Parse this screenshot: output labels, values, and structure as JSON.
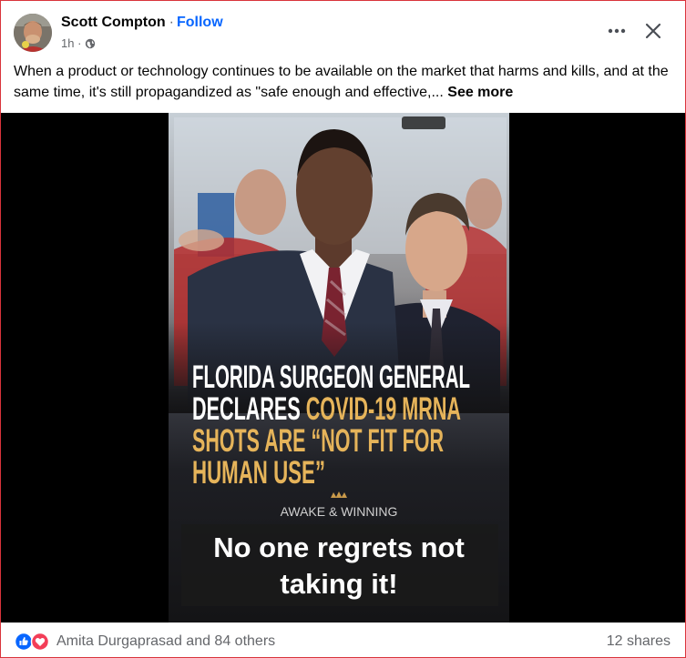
{
  "post": {
    "author": "Scott Compton",
    "separator": "·",
    "follow_label": "Follow",
    "timestamp": "1h ·",
    "audience_icon": "globe-icon",
    "text": "When a product or technology continues to be available on the market that harms and kills, and at the same time, it's still propagandized as \"safe enough and effective,... ",
    "see_more_label": "See more"
  },
  "media": {
    "headline_white_1": "FLORIDA SURGEON GENERAL",
    "headline_white_2": "DECLARES ",
    "headline_gold_2": "COVID-19 MRNA",
    "headline_gold_3": "SHOTS ARE “NOT FIT FOR",
    "headline_gold_4": "HUMAN USE”",
    "brand": "AWAKE & WINNING",
    "caption_line_1": "No one regrets not",
    "caption_line_2": "taking it!"
  },
  "footer": {
    "reaction_icons": [
      "like-icon",
      "love-icon"
    ],
    "reactions_text": "Amita Durgaprasad and 84 others",
    "shares_text": "12 shares"
  },
  "colors": {
    "accent": "#0866ff",
    "gold": "#e6b45a",
    "love": "#f33e58"
  }
}
